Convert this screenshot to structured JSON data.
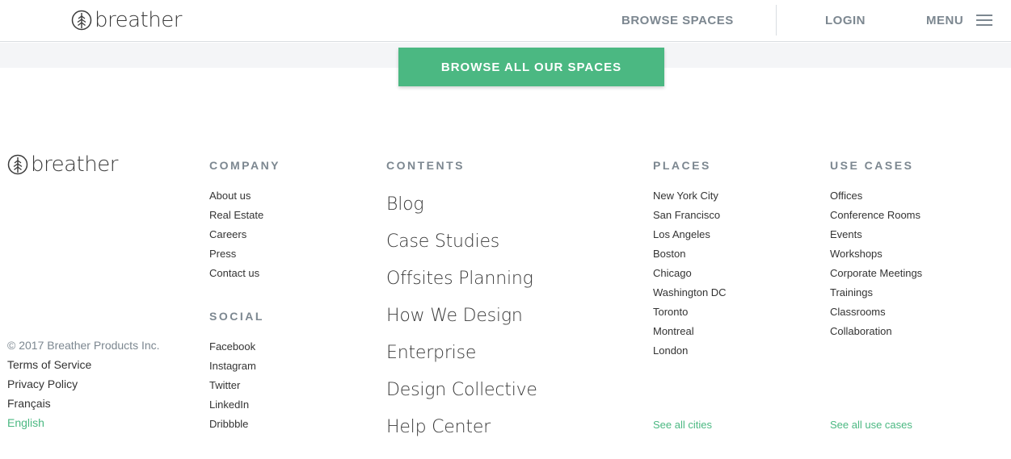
{
  "header": {
    "logo_text": "breather",
    "browse_spaces": "BROWSE SPACES",
    "login": "LOGIN",
    "menu": "MENU"
  },
  "cta": {
    "label": "BROWSE ALL OUR SPACES"
  },
  "footer": {
    "logo_text": "breather",
    "company": {
      "heading": "COMPANY",
      "items": [
        "About us",
        "Real Estate",
        "Careers",
        "Press",
        "Contact us"
      ]
    },
    "social": {
      "heading": "SOCIAL",
      "items": [
        "Facebook",
        "Instagram",
        "Twitter",
        "LinkedIn",
        "Dribbble"
      ]
    },
    "contents": {
      "heading": "CONTENTS",
      "items": [
        "Blog",
        "Case Studies",
        "Offsites Planning",
        "How We Design",
        "Enterprise",
        "Design Collective",
        "Help Center"
      ]
    },
    "places": {
      "heading": "PLACES",
      "items": [
        "New York City",
        "San Francisco",
        "Los Angeles",
        "Boston",
        "Chicago",
        "Washington DC",
        "Toronto",
        "Montreal",
        "London"
      ],
      "see_all": "See all cities"
    },
    "use_cases": {
      "heading": "USE CASES",
      "items": [
        "Offices",
        "Conference Rooms",
        "Events",
        "Workshops",
        "Corporate Meetings",
        "Trainings",
        "Classrooms",
        "Collaboration"
      ],
      "see_all": "See all use cases"
    },
    "legal": {
      "copyright": "© 2017 Breather Products Inc.",
      "terms": "Terms of Service",
      "privacy": "Privacy Policy",
      "french": "Français",
      "english": "English"
    }
  },
  "colors": {
    "accent": "#4bb882",
    "heading": "#7c8790",
    "band": "#f4f5f7"
  }
}
